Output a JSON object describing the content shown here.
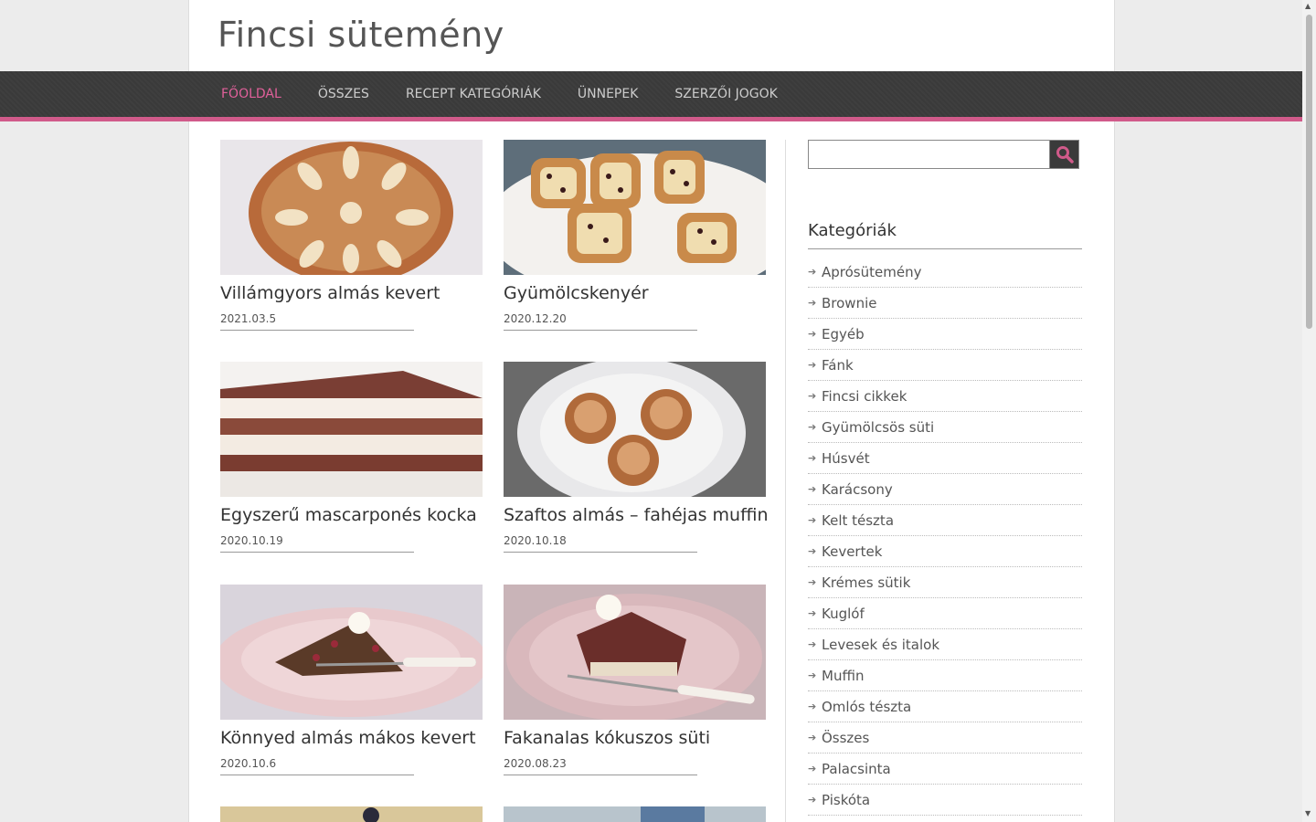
{
  "site": {
    "title": "Fincsi sütemény"
  },
  "nav": {
    "items": [
      {
        "label": "Főoldal",
        "active": true
      },
      {
        "label": "Összes"
      },
      {
        "label": "Recept kategóriák"
      },
      {
        "label": "Ünnepek"
      },
      {
        "label": "Szerzői jogok"
      }
    ]
  },
  "posts": [
    {
      "title": "Villámgyors almás kevert",
      "date": "2021.03.5"
    },
    {
      "title": "Gyümölcskenyér",
      "date": "2020.12.20"
    },
    {
      "title": "Egyszerű mascarponés kocka",
      "date": "2020.10.19"
    },
    {
      "title": "Szaftos almás – fahéjas muffin",
      "date": "2020.10.18"
    },
    {
      "title": "Könnyed almás mákos kevert",
      "date": "2020.10.6"
    },
    {
      "title": "Fakanalas kókuszos süti",
      "date": "2020.08.23"
    }
  ],
  "search": {
    "placeholder": "",
    "icon": "search-icon"
  },
  "sidebar": {
    "categories_title": "Kategóriák",
    "categories": [
      "Aprósütemény",
      "Brownie",
      "Egyéb",
      "Fánk",
      "Fincsi cikkek",
      "Gyümölcsös süti",
      "Húsvét",
      "Karácsony",
      "Kelt tészta",
      "Kevertek",
      "Krémes sütik",
      "Kuglóf",
      "Levesek és italok",
      "Muffin",
      "Omlós tészta",
      "Összes",
      "Palacsinta",
      "Piskóta"
    ]
  },
  "colors": {
    "accent": "#d15a8a",
    "nav_bg": "#3a3a3a"
  }
}
